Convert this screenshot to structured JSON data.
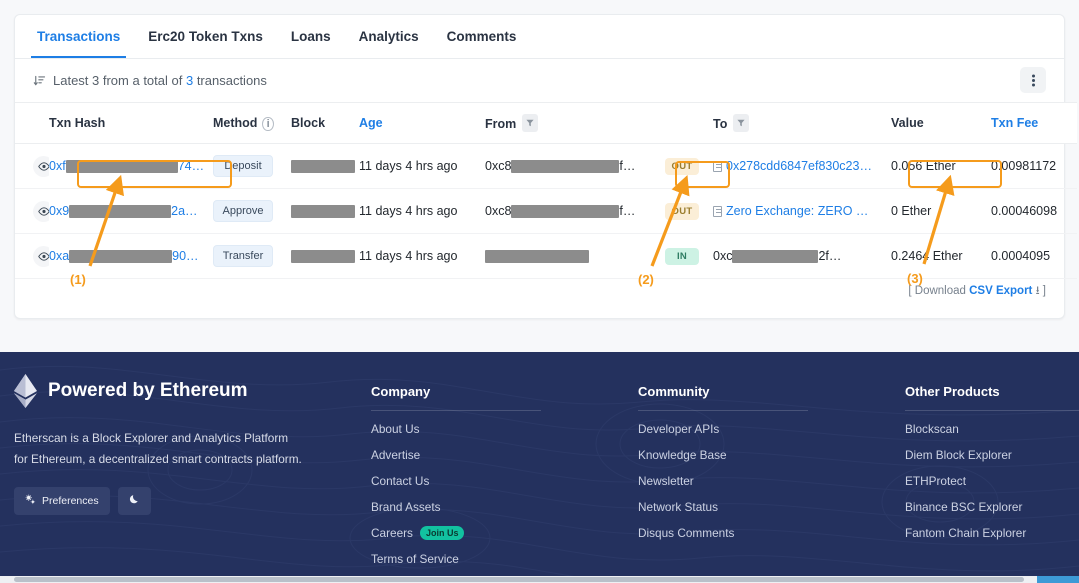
{
  "tabs": [
    {
      "label": "Transactions",
      "active": true
    },
    {
      "label": "Erc20 Token Txns",
      "active": false
    },
    {
      "label": "Loans",
      "active": false
    },
    {
      "label": "Analytics",
      "active": false
    },
    {
      "label": "Comments",
      "active": false
    }
  ],
  "subheader": {
    "sort_icon": "sort-descending-icon",
    "prefix": "Latest 3 from a total of ",
    "count": "3",
    "suffix": " transactions",
    "menu_icon": "kebab-menu-icon"
  },
  "table": {
    "columns": [
      {
        "key": "eye",
        "label": ""
      },
      {
        "key": "hash",
        "label": "Txn Hash"
      },
      {
        "key": "method",
        "label": "Method",
        "info_icon": "info-icon"
      },
      {
        "key": "block",
        "label": "Block"
      },
      {
        "key": "age",
        "label": "Age",
        "is_link": true
      },
      {
        "key": "from",
        "label": "From",
        "filter_icon": "filter-icon"
      },
      {
        "key": "dir",
        "label": ""
      },
      {
        "key": "to",
        "label": "To",
        "filter_icon": "filter-icon"
      },
      {
        "key": "value",
        "label": "Value"
      },
      {
        "key": "fee",
        "label": "Txn Fee",
        "is_link": true
      }
    ],
    "rows": [
      {
        "hash_prefix": "0xf",
        "hash_redacted_width": 112,
        "hash_suffix": "74…",
        "method": "Deposit",
        "block_redacted_width": 64,
        "age": "11 days 4 hrs ago",
        "from_prefix": "0xc8",
        "from_redacted_width": 108,
        "from_suffix": "f…",
        "direction": "OUT",
        "to_prefix": "",
        "to_redacted_width": 0,
        "to_text": "0x278cdd6847ef830c23…",
        "to_is_link": true,
        "to_has_icon": true,
        "value": "0.056 Ether",
        "fee": "0.00981172"
      },
      {
        "hash_prefix": "0x9",
        "hash_redacted_width": 102,
        "hash_suffix": "2a…",
        "method": "Approve",
        "block_redacted_width": 64,
        "age": "11 days 4 hrs ago",
        "from_prefix": "0xc8",
        "from_redacted_width": 108,
        "from_suffix": "f…",
        "direction": "OUT",
        "to_prefix": "",
        "to_redacted_width": 0,
        "to_text": "Zero Exchange: ZERO …",
        "to_is_link": true,
        "to_has_icon": true,
        "value": "0 Ether",
        "fee": "0.00046098"
      },
      {
        "hash_prefix": "0xa",
        "hash_redacted_width": 103,
        "hash_suffix": "90…",
        "method": "Transfer",
        "block_redacted_width": 64,
        "age": "11 days 4 hrs ago",
        "from_prefix": "",
        "from_redacted_width": 104,
        "from_suffix": "",
        "direction": "IN",
        "to_prefix": "0xc",
        "to_redacted_width": 86,
        "to_text": "2f…",
        "to_is_link": false,
        "to_has_icon": false,
        "value": "0.2464 Ether",
        "fee": "0.0004095"
      }
    ]
  },
  "download": {
    "open_bracket": "[ ",
    "prefix": "Download ",
    "link": "CSV Export",
    "icon": "download-icon",
    "close_bracket": " ]"
  },
  "annotations": {
    "color": "#f59b1c",
    "labels": [
      {
        "id": "1",
        "text": "(1)"
      },
      {
        "id": "2",
        "text": "(2)"
      },
      {
        "id": "3",
        "text": "(3)"
      }
    ]
  },
  "footer": {
    "brand": {
      "logo_icon": "ethereum-logo-icon",
      "title": "Powered by Ethereum",
      "description": "Etherscan is a Block Explorer and Analytics Platform for Ethereum, a decentralized smart contracts platform.",
      "preferences_button": "Preferences",
      "preferences_icon": "settings-gears-icon",
      "darkmode_icon": "moon-icon"
    },
    "columns": [
      {
        "title": "Company",
        "links": [
          {
            "label": "About Us"
          },
          {
            "label": "Advertise"
          },
          {
            "label": "Contact Us"
          },
          {
            "label": "Brand Assets"
          },
          {
            "label": "Careers",
            "badge": "Join Us"
          },
          {
            "label": "Terms of Service"
          }
        ]
      },
      {
        "title": "Community",
        "links": [
          {
            "label": "Developer APIs"
          },
          {
            "label": "Knowledge Base"
          },
          {
            "label": "Newsletter"
          },
          {
            "label": "Network Status"
          },
          {
            "label": "Disqus Comments"
          }
        ]
      },
      {
        "title": "Other Products",
        "links": [
          {
            "label": "Blockscan"
          },
          {
            "label": "Diem Block Explorer"
          },
          {
            "label": "ETHProtect"
          },
          {
            "label": "Binance BSC Explorer"
          },
          {
            "label": "Fantom Chain Explorer"
          }
        ]
      }
    ]
  },
  "colors": {
    "accent_blue": "#1e7ee5",
    "annotation_orange": "#f59b1c",
    "footer_navy": "#24315e",
    "out_badge": "#fbeed7",
    "in_badge": "#cdf2e4",
    "join_badge": "#12c2a0"
  }
}
